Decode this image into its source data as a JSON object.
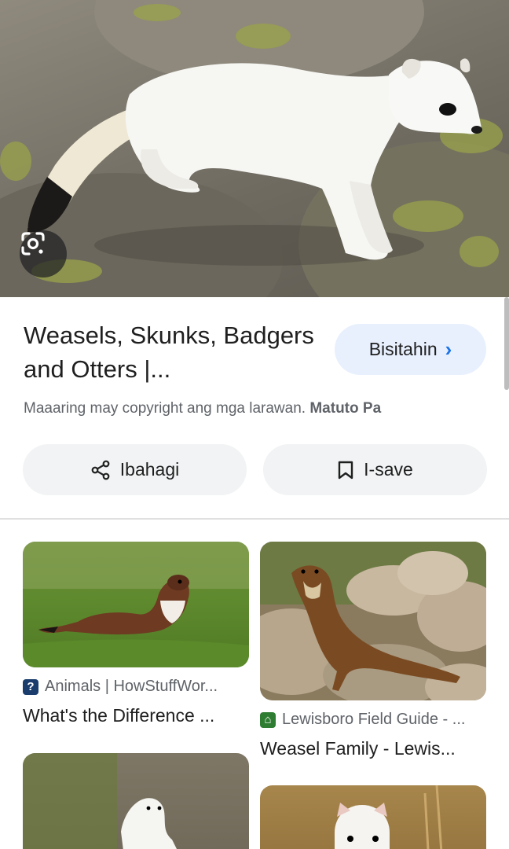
{
  "hero": {
    "lens_icon": "google-lens-icon",
    "subject": "white-ermine-on-rock"
  },
  "result": {
    "title": "Weasels, Skunks, Badgers and Otters |...",
    "visit_label": "Bisitahin",
    "visit_icon": "chevron-right-icon",
    "copyright_text": "Maaaring may copyright ang mga larawan.",
    "learn_more": "Matuto Pa",
    "share_label": "Ibahagi",
    "share_icon": "share-icon",
    "save_label": "I-save",
    "save_icon": "bookmark-icon"
  },
  "related": [
    {
      "source": "Animals | HowStuffWor...",
      "title": "What's the Difference ...",
      "favicon": "howstuffworks-favicon",
      "favicon_color": "#1a3d6d"
    },
    {
      "source": "Lewisboro Field Guide - ...",
      "title": "Weasel Family - Lewis...",
      "favicon": "lewisboro-favicon",
      "favicon_color": "#2e7d32"
    }
  ],
  "colors": {
    "accent": "#1a73e8",
    "visit_bg": "#e8f0fe",
    "chip_bg": "#f1f3f4"
  }
}
